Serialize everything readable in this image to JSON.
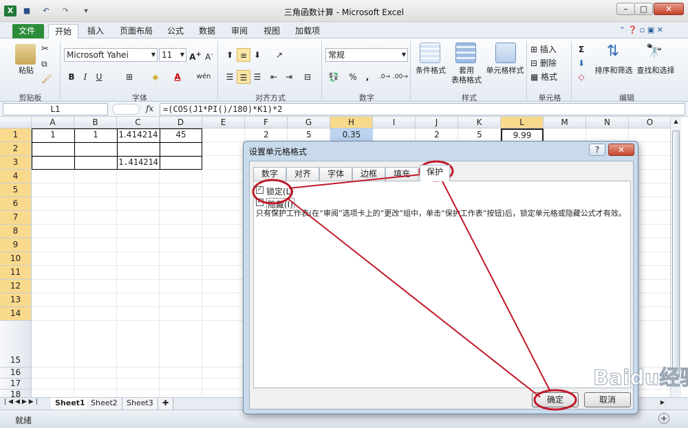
{
  "window": {
    "title": "三角函数计算 - Microsoft Excel"
  },
  "ribbon_tabs": [
    "文件",
    "开始",
    "插入",
    "页面布局",
    "公式",
    "数据",
    "审阅",
    "视图",
    "加载项"
  ],
  "ribbon": {
    "clipboard": {
      "paste": "粘贴",
      "label": "剪贴板"
    },
    "font": {
      "name": "Microsoft Yahei",
      "size": "11",
      "label": "字体",
      "bold": "B",
      "italic": "I",
      "underline": "U"
    },
    "alignment": {
      "label": "对齐方式"
    },
    "number": {
      "format": "常规",
      "label": "数字",
      "percent": "%",
      "comma": ","
    },
    "styles": {
      "conditional": "条件格式",
      "table_line1": "套用",
      "table_line2": "表格格式",
      "cell_styles": "单元格样式",
      "label": "样式"
    },
    "cells": {
      "insert": "插入",
      "delete": "删除",
      "format": "格式",
      "label": "单元格"
    },
    "editing": {
      "sum": "Σ",
      "sort": "排序和筛选",
      "find": "查找和选择",
      "label": "编辑"
    }
  },
  "formula_bar": {
    "name_box": "L1",
    "fx": "fx",
    "formula": "=(COS(J1*PI()/180)*K1)*2"
  },
  "columns": [
    "A",
    "B",
    "C",
    "D",
    "E",
    "F",
    "G",
    "H",
    "I",
    "J",
    "K",
    "L",
    "M",
    "N",
    "O"
  ],
  "rows": [
    "1",
    "2",
    "3",
    "4",
    "5",
    "6",
    "7",
    "8",
    "9",
    "10",
    "11",
    "12",
    "13",
    "14",
    "15",
    "16",
    "17",
    "18"
  ],
  "cells": {
    "A1": "1",
    "B1": "1",
    "C1": "1.414214",
    "D1": "45",
    "F1": "2",
    "G1": "5",
    "H1": "0.35",
    "J1": "2",
    "K1": "5",
    "L1": "9.99",
    "C3": "1.414214"
  },
  "sheets": [
    "Sheet1",
    "Sheet2",
    "Sheet3"
  ],
  "status": {
    "ready": "就绪"
  },
  "dialog": {
    "title": "设置单元格格式",
    "help": "?",
    "close": "✕",
    "tabs": [
      "数字",
      "对齐",
      "字体",
      "边框",
      "填充",
      "保护"
    ],
    "active_tab": "保护",
    "locked_label": "锁定(L)",
    "hidden_label": "隐藏(I)",
    "locked_checked": true,
    "hidden_checked": true,
    "note": "只有保护工作表(在“审阅”选项卡上的“更改”组中，单击“保护工作表”按钮)后，锁定单元格或隐藏公式才有效。",
    "ok": "确定",
    "cancel": "取消"
  },
  "colors": {
    "annotation": "#c0182a",
    "excel_green": "#2d8c3a",
    "selected_header": "#f9d98b"
  },
  "watermark": "Baidu经验"
}
